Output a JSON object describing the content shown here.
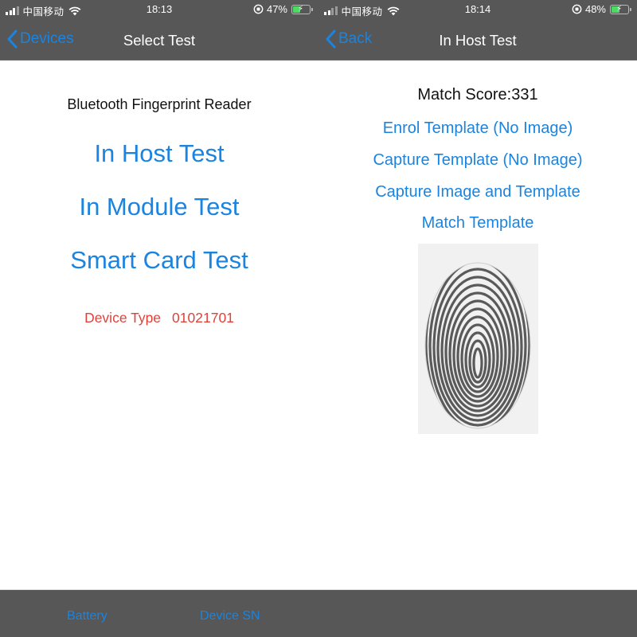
{
  "screens": [
    {
      "status": {
        "carrier": "中国移动",
        "time": "18:13",
        "battery_percent": "47%",
        "battery_level": 0.47
      },
      "nav": {
        "back_label": "Devices",
        "title": "Select Test"
      },
      "content": {
        "subtitle": "Bluetooth Fingerprint Reader",
        "buttons": [
          "In Host Test",
          "In Module Test",
          "Smart Card Test"
        ],
        "device_type_label": "Device Type",
        "device_type_value": "01021701"
      },
      "toolbar": {
        "items": [
          "Battery",
          "Device SN"
        ]
      }
    },
    {
      "status": {
        "carrier": "中国移动",
        "time": "18:14",
        "battery_percent": "48%",
        "battery_level": 0.48
      },
      "nav": {
        "back_label": "Back",
        "title": "In Host Test"
      },
      "content": {
        "match_score": "Match Score:331",
        "options": [
          "Enrol Template (No Image)",
          "Capture Template (No Image)",
          "Capture Image and Template",
          "Match Template"
        ],
        "image": "fingerprint-image"
      }
    }
  ],
  "colors": {
    "accent": "#1a84e0",
    "bar": "#575757",
    "device_type": "#e0413a",
    "battery_fill": "#4cd964"
  }
}
